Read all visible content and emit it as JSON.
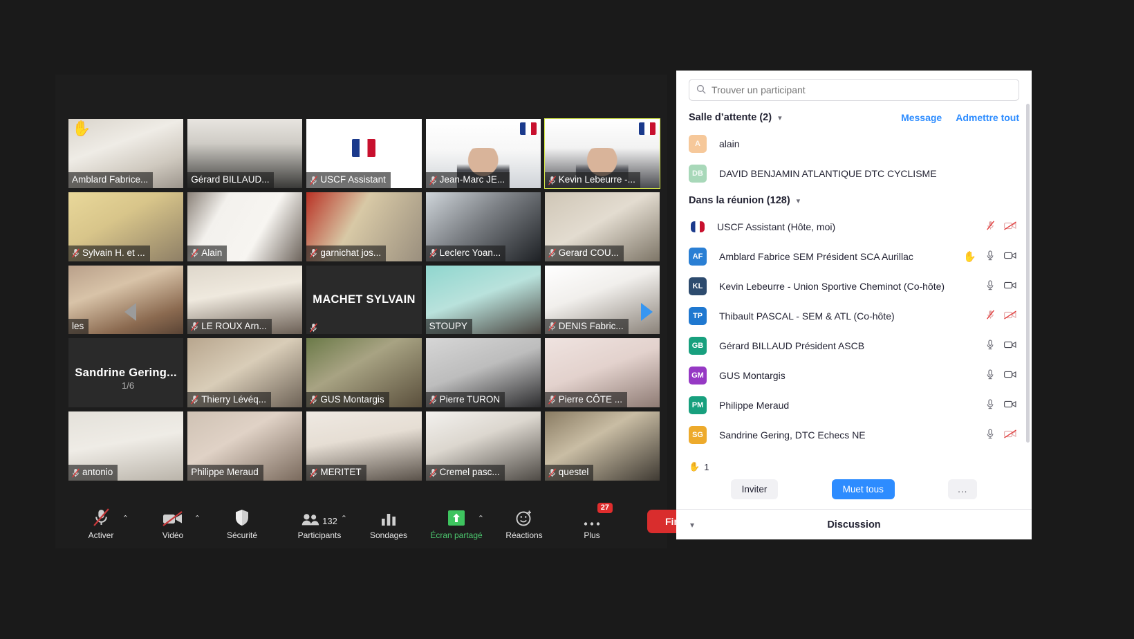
{
  "app": "zoom-meeting",
  "video_grid": {
    "page_indicator_left": "1/6",
    "page_indicator_right": "1/6",
    "tiles": [
      {
        "name": "Amblard Fabrice...",
        "muted": false,
        "hand": true,
        "style": "room-light",
        "highlight": false
      },
      {
        "name": "Gérard BILLAUD...",
        "muted": false,
        "hand": false,
        "style": "man-glasses",
        "highlight": false
      },
      {
        "name": "USCF Assistant",
        "muted": true,
        "hand": false,
        "style": "logo-card",
        "highlight": false
      },
      {
        "name": "Jean-Marc JE...",
        "muted": true,
        "hand": false,
        "style": "slide-man",
        "highlight": false
      },
      {
        "name": "Kevin Lebeurre -...",
        "muted": true,
        "hand": false,
        "style": "slide-man2",
        "highlight": true
      },
      {
        "name": "Sylvain H. et ...",
        "muted": true,
        "hand": false,
        "style": "yellow-room",
        "highlight": false
      },
      {
        "name": "Alain",
        "muted": true,
        "hand": false,
        "style": "white-board",
        "highlight": false
      },
      {
        "name": "garnichat jos...",
        "muted": true,
        "hand": false,
        "style": "cgt-poster",
        "highlight": false
      },
      {
        "name": "Leclerc Yoan...",
        "muted": true,
        "hand": false,
        "style": "dark-office",
        "highlight": false
      },
      {
        "name": "Gerard COU...",
        "muted": true,
        "hand": false,
        "style": "beige-room",
        "highlight": false
      },
      {
        "name": "les",
        "muted": false,
        "hand": false,
        "style": "meeting-room",
        "highlight": false
      },
      {
        "name": "LE ROUX Arn...",
        "muted": true,
        "hand": false,
        "style": "headset-man",
        "highlight": false
      },
      {
        "name": "MACHET SYLVAIN",
        "muted": true,
        "hand": false,
        "style": "name-only",
        "highlight": false,
        "center_name": true
      },
      {
        "name": "STOUPY",
        "muted": false,
        "hand": false,
        "style": "teal-curtain",
        "highlight": false
      },
      {
        "name": "DENIS Fabric...",
        "muted": true,
        "hand": false,
        "style": "logos-man",
        "highlight": false
      },
      {
        "name": "Sandrine  Gering...",
        "muted": false,
        "hand": false,
        "style": "name-only",
        "highlight": false,
        "center_name": true
      },
      {
        "name": "Thierry Lévéq...",
        "muted": true,
        "hand": false,
        "style": "stone-wall",
        "highlight": false
      },
      {
        "name": "GUS Montargis",
        "muted": true,
        "hand": false,
        "style": "plant-room",
        "highlight": false
      },
      {
        "name": "Pierre TURON",
        "muted": true,
        "hand": false,
        "style": "grey-wall",
        "highlight": false
      },
      {
        "name": "Pierre CÔTE ...",
        "muted": true,
        "hand": false,
        "style": "pink-room",
        "highlight": false
      },
      {
        "name": "antonio",
        "muted": true,
        "hand": false,
        "style": "pale-wall",
        "highlight": false
      },
      {
        "name": "Philippe Meraud",
        "muted": false,
        "hand": false,
        "style": "interior",
        "highlight": false
      },
      {
        "name": "MERITET",
        "muted": true,
        "hand": false,
        "style": "woman-glasses",
        "highlight": false
      },
      {
        "name": "Cremel pasc...",
        "muted": true,
        "hand": false,
        "style": "earphone-man",
        "highlight": false
      },
      {
        "name": "questel",
        "muted": true,
        "hand": false,
        "style": "cabinet-man",
        "highlight": false
      }
    ]
  },
  "toolbar": {
    "items": [
      {
        "label": "Activer",
        "icon": "mic-muted-icon",
        "caret": true,
        "badge": null,
        "green": false
      },
      {
        "label": "Vidéo",
        "icon": "video-off-icon",
        "caret": true,
        "badge": null,
        "green": false
      },
      {
        "label": "Sécurité",
        "icon": "shield-icon",
        "caret": false,
        "badge": null,
        "green": false
      },
      {
        "label": "Participants",
        "icon": "participants-icon",
        "caret": true,
        "badge": null,
        "green": false,
        "count": "132"
      },
      {
        "label": "Sondages",
        "icon": "polls-icon",
        "caret": false,
        "badge": null,
        "green": false
      },
      {
        "label": "Écran partagé",
        "icon": "share-screen-icon",
        "caret": true,
        "badge": null,
        "green": true
      },
      {
        "label": "Réactions",
        "icon": "reactions-icon",
        "caret": false,
        "badge": null,
        "green": false
      },
      {
        "label": "Plus",
        "icon": "more-icon",
        "caret": false,
        "badge": "27",
        "green": false
      }
    ],
    "end_label": "Fin"
  },
  "panel": {
    "search_placeholder": "Trouver un participant",
    "search_value": "",
    "waiting_room": {
      "title": "Salle d’attente (2)",
      "message_label": "Message",
      "admit_all_label": "Admettre tout",
      "people": [
        {
          "initials": "A",
          "name": "alain",
          "color": "#f6c89a",
          "text_color": "#ffffff"
        },
        {
          "initials": "DB",
          "name": "DAVID BENJAMIN ATLANTIQUE DTC CYCLISME",
          "color": "#a8d8b9",
          "text_color": "#ffffff"
        }
      ]
    },
    "in_meeting": {
      "title": "Dans la réunion (128)",
      "people": [
        {
          "initials": "",
          "name": "USCF Assistant (Hôte, moi)",
          "color": "#ffffff",
          "flag": true,
          "mic": "muted-red",
          "cam": "off-red",
          "hand": false
        },
        {
          "initials": "AF",
          "name": "Amblard Fabrice SEM Président SCA Aurillac",
          "color": "#2a7fd4",
          "mic": "on",
          "cam": "on",
          "hand": true
        },
        {
          "initials": "KL",
          "name": "Kevin Lebeurre - Union Sportive Cheminot (Co-hôte)",
          "color": "#2d4b6e",
          "mic": "on",
          "cam": "on",
          "hand": false
        },
        {
          "initials": "TP",
          "name": "Thibault PASCAL - SEM & ATL (Co-hôte)",
          "color": "#1f78d0",
          "mic": "muted-red",
          "cam": "off-red",
          "hand": false
        },
        {
          "initials": "GB",
          "name": "Gérard BILLAUD Président ASCB",
          "color": "#18a07e",
          "mic": "on",
          "cam": "on",
          "hand": false
        },
        {
          "initials": "GM",
          "name": "GUS Montargis",
          "color": "#9639c4",
          "mic": "on",
          "cam": "on",
          "hand": false
        },
        {
          "initials": "PM",
          "name": "Philippe Meraud",
          "color": "#18a07e",
          "mic": "on",
          "cam": "on",
          "hand": false
        },
        {
          "initials": "SG",
          "name": "Sandrine Gering,  DTC Echecs NE",
          "color": "#edaa2c",
          "mic": "on",
          "cam": "off-red",
          "hand": false
        }
      ]
    },
    "hand_count": "1",
    "buttons": {
      "invite": "Inviter",
      "mute_all": "Muet tous",
      "more": "..."
    },
    "discussion_label": "Discussion"
  },
  "colors": {
    "accent_blue": "#2d8cff",
    "end_red": "#d92d2d",
    "share_green": "#4cc76e",
    "highlight_yellow": "#d6ea4a"
  }
}
